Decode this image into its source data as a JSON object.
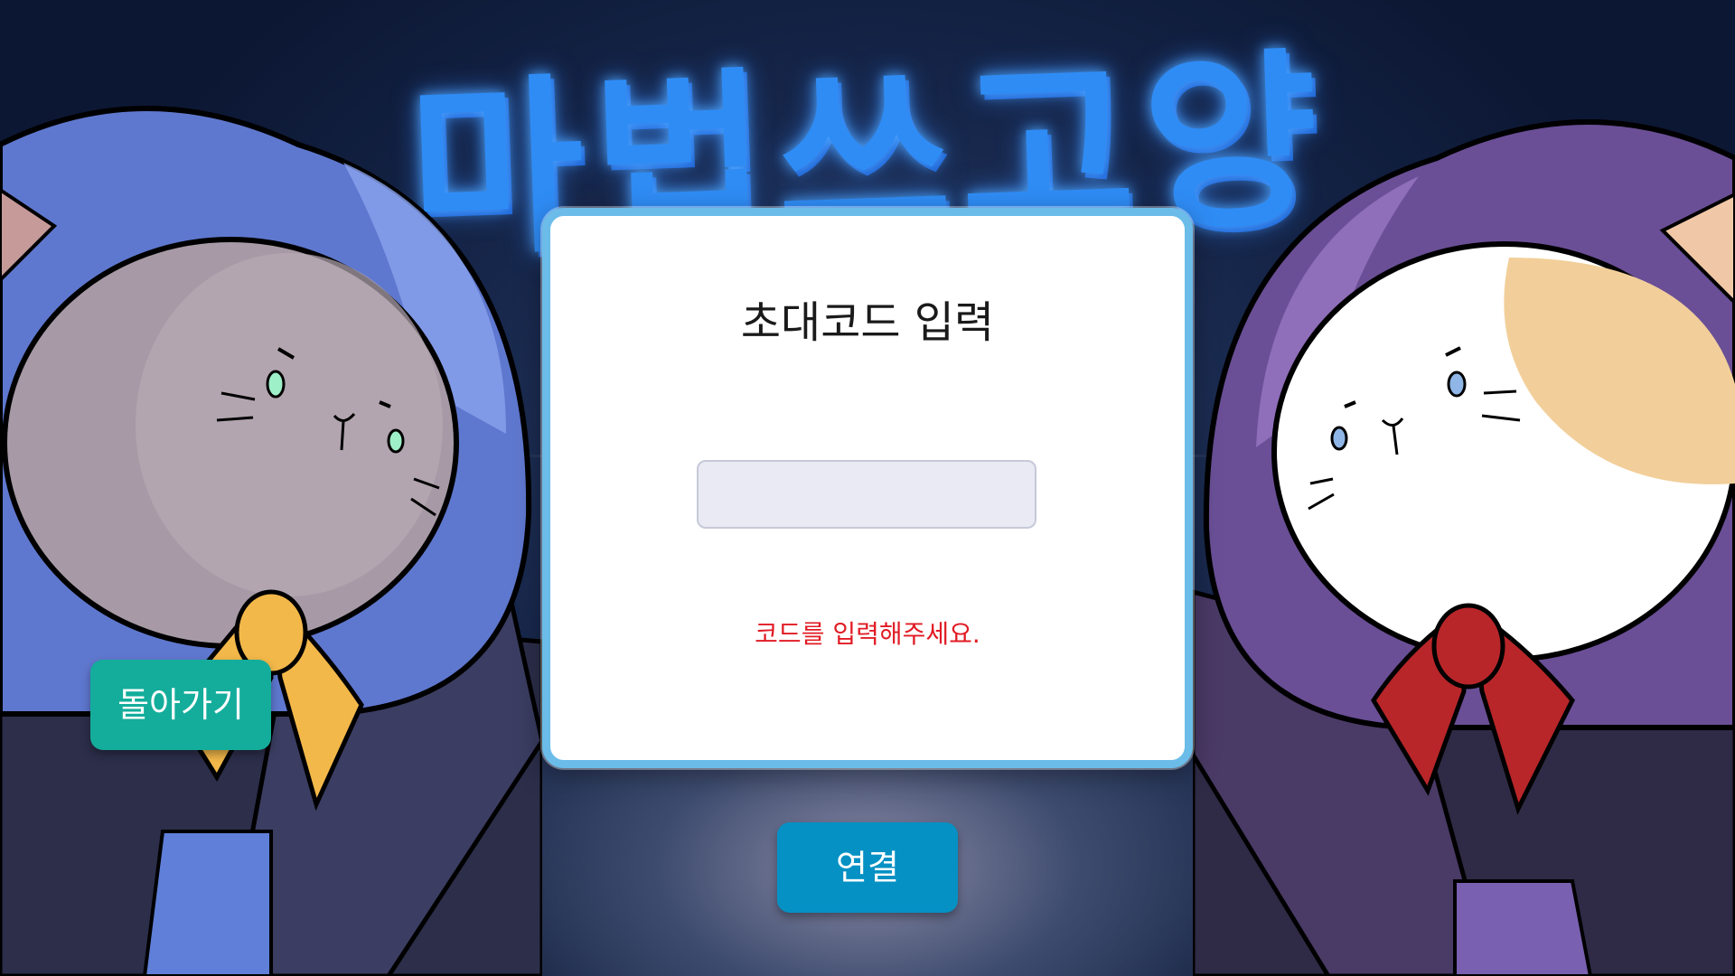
{
  "title_art": {
    "text": "마법쓰고양"
  },
  "dialog": {
    "title": "초대코드 입력",
    "input": {
      "value": "",
      "placeholder": ""
    },
    "error": "코드를 입력해주세요."
  },
  "buttons": {
    "back": "돌아가기",
    "connect": "연결"
  },
  "colors": {
    "dialog_border": "#6bbce8",
    "error": "#e11b24",
    "back_button": "#14ad9b",
    "connect_button": "#0591c4",
    "title_glow": "#2f8cf5"
  },
  "characters": [
    {
      "name": "blue-hooded-gray-cat",
      "hood": "#6f86dc",
      "face": "#a79aa6",
      "ribbon": "#f3b84a",
      "eyes": "#9ef0c8"
    },
    {
      "name": "purple-hooded-calico-cat",
      "hood": "#8a66b4",
      "face": "#ffffff",
      "ribbon": "#b8262a",
      "eyes": "#8fb6e6"
    }
  ]
}
